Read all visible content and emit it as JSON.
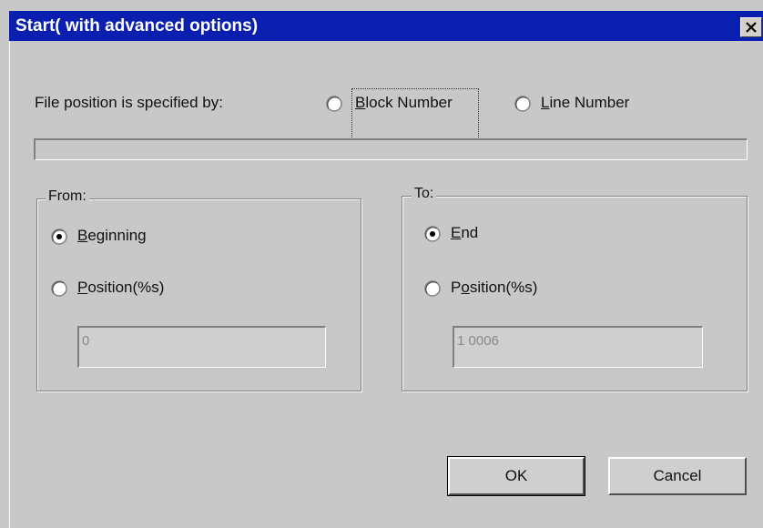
{
  "dialog": {
    "title": "Start( with advanced options)"
  },
  "file_position": {
    "label": "File position is specified by:",
    "options": [
      {
        "label": "Block Number",
        "mnemonic": "B",
        "rest": "lock Number",
        "selected": false,
        "focused": true
      },
      {
        "label": "Line Number",
        "mnemonic": "L",
        "rest": "ine Number",
        "selected": false
      }
    ]
  },
  "progress": {
    "value": 0
  },
  "from_group": {
    "legend": "From:",
    "beginning_mnemonic": "B",
    "beginning_rest": "eginning",
    "beginning_selected": true,
    "position_mnemonic": "P",
    "position_rest": "osition(%s)",
    "position_selected": false,
    "position_value": "0"
  },
  "to_group": {
    "legend": "To:",
    "end_mnemonic": "E",
    "end_rest": "nd",
    "end_selected": true,
    "position_prefix": "P",
    "position_mnemonic": "o",
    "position_rest": "sition(%s)",
    "position_selected": false,
    "position_value": "1 0006"
  },
  "buttons": {
    "ok": "OK",
    "cancel": "Cancel"
  },
  "icons": {
    "close": "close-icon",
    "radio": "radio-button-icon"
  }
}
